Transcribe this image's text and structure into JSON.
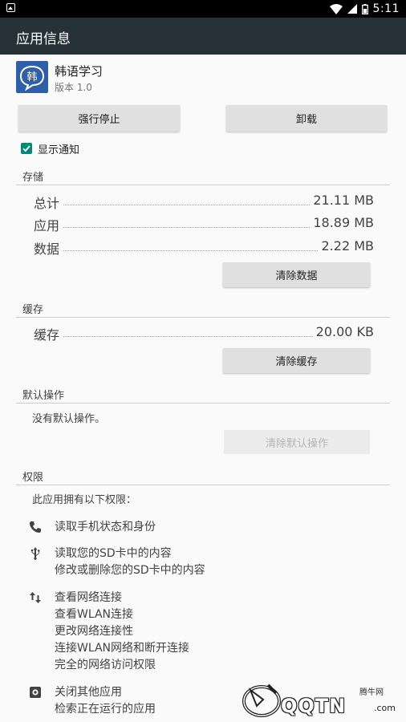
{
  "status_bar": {
    "time": "5:11"
  },
  "app_bar": {
    "title": "应用信息"
  },
  "app": {
    "name": "韩语学习",
    "version": "版本 1.0",
    "icon_text": "韩",
    "icon_color": "#2f5fa8"
  },
  "actions": {
    "force_stop": "强行停止",
    "uninstall": "卸载"
  },
  "notification": {
    "label": "显示通知",
    "checked": true,
    "accent": "#00897b"
  },
  "storage": {
    "header": "存储",
    "rows": [
      {
        "label": "总计",
        "value": "21.11 MB"
      },
      {
        "label": "应用",
        "value": "18.89 MB"
      },
      {
        "label": "数据",
        "value": "2.22 MB"
      }
    ],
    "clear_data": "清除数据"
  },
  "cache": {
    "header": "缓存",
    "rows": [
      {
        "label": "缓存",
        "value": "20.00 KB"
      }
    ],
    "clear_cache": "清除缓存"
  },
  "defaults": {
    "header": "默认操作",
    "none_text": "没有默认操作。",
    "clear_defaults": "清除默认操作"
  },
  "permissions": {
    "header": "权限",
    "intro": "此应用拥有以下权限：",
    "groups": [
      {
        "icon": "phone-icon",
        "items": [
          "读取手机状态和身份"
        ]
      },
      {
        "icon": "usb-icon",
        "items": [
          "读取您的SD卡中的内容",
          "修改或删除您的SD卡中的内容"
        ]
      },
      {
        "icon": "network-arrows-icon",
        "items": [
          "查看网络连接",
          "查看WLAN连接",
          "更改网络连接性",
          "连接WLAN网络和断开连接",
          "完全的网络访问权限"
        ]
      },
      {
        "icon": "settings-app-icon",
        "items": [
          "关闭其他应用",
          "检索正在运行的应用"
        ]
      }
    ]
  },
  "watermark": {
    "brand": "QQTN",
    "small": "腾牛网",
    "suffix": ".com"
  }
}
